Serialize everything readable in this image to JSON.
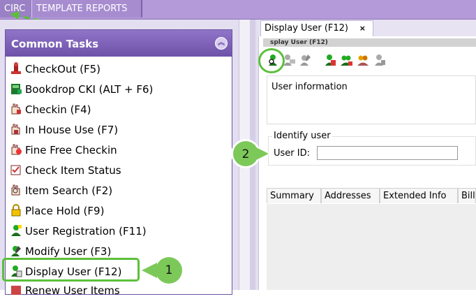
{
  "top_tabs": [
    {
      "label": "CIRC",
      "active": true
    },
    {
      "label": "TEMPLATE REPORTS",
      "active": false
    }
  ],
  "common_tasks": {
    "title": "Common Tasks",
    "collapse_icon": "double-chevron-up-icon",
    "items": [
      {
        "label": "CheckOut (F5)",
        "icon": "stamp-icon"
      },
      {
        "label": "Bookdrop CKI (ALT + F6)",
        "icon": "bookdrop-icon"
      },
      {
        "label": "Checkin (F4)",
        "icon": "checkin-hand-icon"
      },
      {
        "label": "In House Use (F7)",
        "icon": "in-house-hand-icon"
      },
      {
        "label": "Fine Free Checkin",
        "icon": "fine-free-icon"
      },
      {
        "label": "Check Item Status",
        "icon": "item-status-icon"
      },
      {
        "label": "Item Search (F2)",
        "icon": "item-search-icon"
      },
      {
        "label": "Place Hold (F9)",
        "icon": "lock-icon"
      },
      {
        "label": "User Registration (F11)",
        "icon": "user-add-icon"
      },
      {
        "label": "Modify User (F3)",
        "icon": "user-edit-icon"
      },
      {
        "label": "Display User (F12)",
        "icon": "user-display-icon"
      },
      {
        "label": "Renew User Items",
        "icon": "renew-icon"
      }
    ]
  },
  "workspace": {
    "tab_label": "Display User (F12)",
    "close_glyph": "×",
    "pane_title": "splay User (F12)",
    "toolbar_icons": [
      "user-search-icon",
      "user-card-icon",
      "user-edit-icon",
      "user-print-icon",
      "user-group-icon",
      "user-merge-icon",
      "user-hand-icon"
    ],
    "user_info_label": "User information",
    "identify_legend": "Identify user",
    "user_id_label": "User ID:",
    "user_id_value": "",
    "tabs": [
      "Summary",
      "Addresses",
      "Extended Info",
      "Bills"
    ]
  },
  "callouts": [
    "1",
    "2"
  ],
  "colors": {
    "accent": "#5cbf3a",
    "header": "#7a5fb6",
    "topbar": "#b49ad8"
  }
}
